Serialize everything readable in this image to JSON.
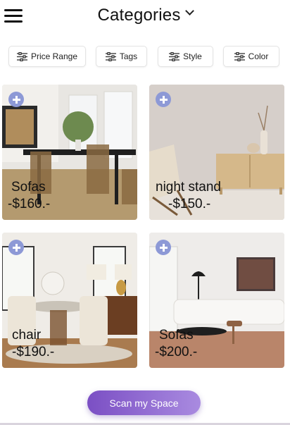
{
  "header": {
    "title": "Categories"
  },
  "filters": [
    {
      "label": "Price Range",
      "icon": "sliders-icon"
    },
    {
      "label": "Tags",
      "icon": "sliders-icon"
    },
    {
      "label": "Style",
      "icon": "sliders-icon"
    },
    {
      "label": "Color",
      "icon": "sliders-icon"
    }
  ],
  "products": [
    {
      "name": "Sofas",
      "price": "-$160.-",
      "scene": "dining room with black table and rattan chairs"
    },
    {
      "name": "night stand",
      "price": "-$150.-",
      "scene": "wooden sideboard with woven lounge chair"
    },
    {
      "name": "chair",
      "price": "-$190.-",
      "scene": "bright room with round table and cream chairs"
    },
    {
      "name": "Sofas",
      "price": "-$200.-",
      "scene": "white living room with long sofa"
    }
  ],
  "cta": {
    "label": "Scan my Space"
  },
  "colors": {
    "accent_start": "#7b4fc4",
    "accent_end": "#a98be0",
    "add_badge": "#8d99d6"
  }
}
